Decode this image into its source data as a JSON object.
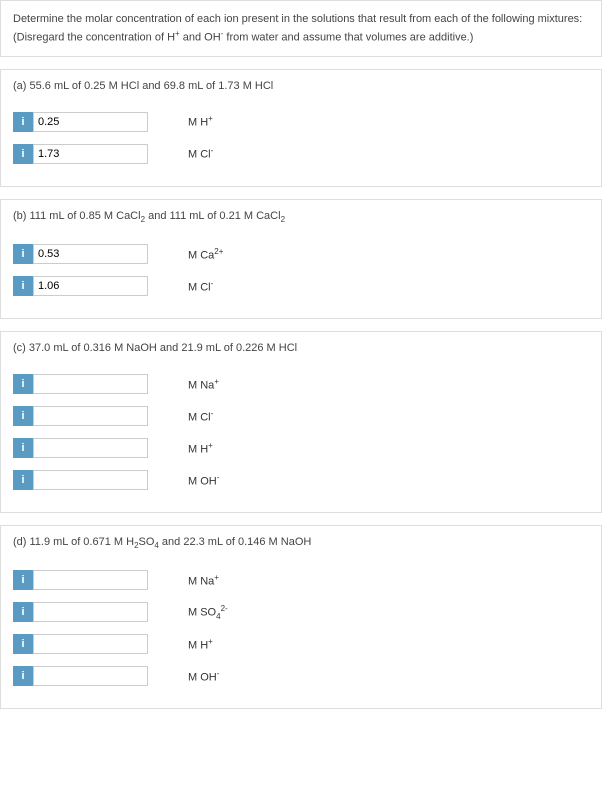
{
  "intro": {
    "line1": "Determine the molar concentration of each ion present in the solutions that result from each of the following mixtures:",
    "line2_pre": "(Disregard the concentration of H",
    "line2_mid": " and OH",
    "line2_post": " from water and assume that volumes are additive.)"
  },
  "parts": {
    "a": {
      "header": "(a) 55.6 mL of 0.25 M HCl and 69.8 mL of 1.73 M HCl",
      "rows": [
        {
          "value": "0.25",
          "label_pre": "M H",
          "label_sup": "+"
        },
        {
          "value": "1.73",
          "label_pre": "M Cl",
          "label_sup": "-"
        }
      ]
    },
    "b": {
      "header_pre": "(b) 111 mL of 0.85 M CaCl",
      "header_mid": " and 111 mL of 0.21 M CaCl",
      "rows": [
        {
          "value": "0.53",
          "label_pre": "M Ca",
          "label_sup": "2+"
        },
        {
          "value": "1.06",
          "label_pre": "M Cl",
          "label_sup": "-"
        }
      ]
    },
    "c": {
      "header": "(c) 37.0 mL of 0.316 M NaOH and 21.9 mL of 0.226 M HCl",
      "rows": [
        {
          "value": "",
          "label_pre": "M Na",
          "label_sup": "+"
        },
        {
          "value": "",
          "label_pre": "M Cl",
          "label_sup": "-"
        },
        {
          "value": "",
          "label_pre": "M H",
          "label_sup": "+"
        },
        {
          "value": "",
          "label_pre": "M OH",
          "label_sup": "-"
        }
      ]
    },
    "d": {
      "header_pre": "(d) 11.9 mL of 0.671 M H",
      "header_mid": "SO",
      "header_post": " and 22.3 mL of 0.146 M NaOH",
      "rows": [
        {
          "value": "",
          "label_pre": "M Na",
          "label_sup": "+"
        },
        {
          "value": "",
          "label_pre": "M SO",
          "label_sub": "4",
          "label_sup": "2-"
        },
        {
          "value": "",
          "label_pre": "M H",
          "label_sup": "+"
        },
        {
          "value": "",
          "label_pre": "M OH",
          "label_sup": "-"
        }
      ]
    }
  },
  "info_icon": "i"
}
